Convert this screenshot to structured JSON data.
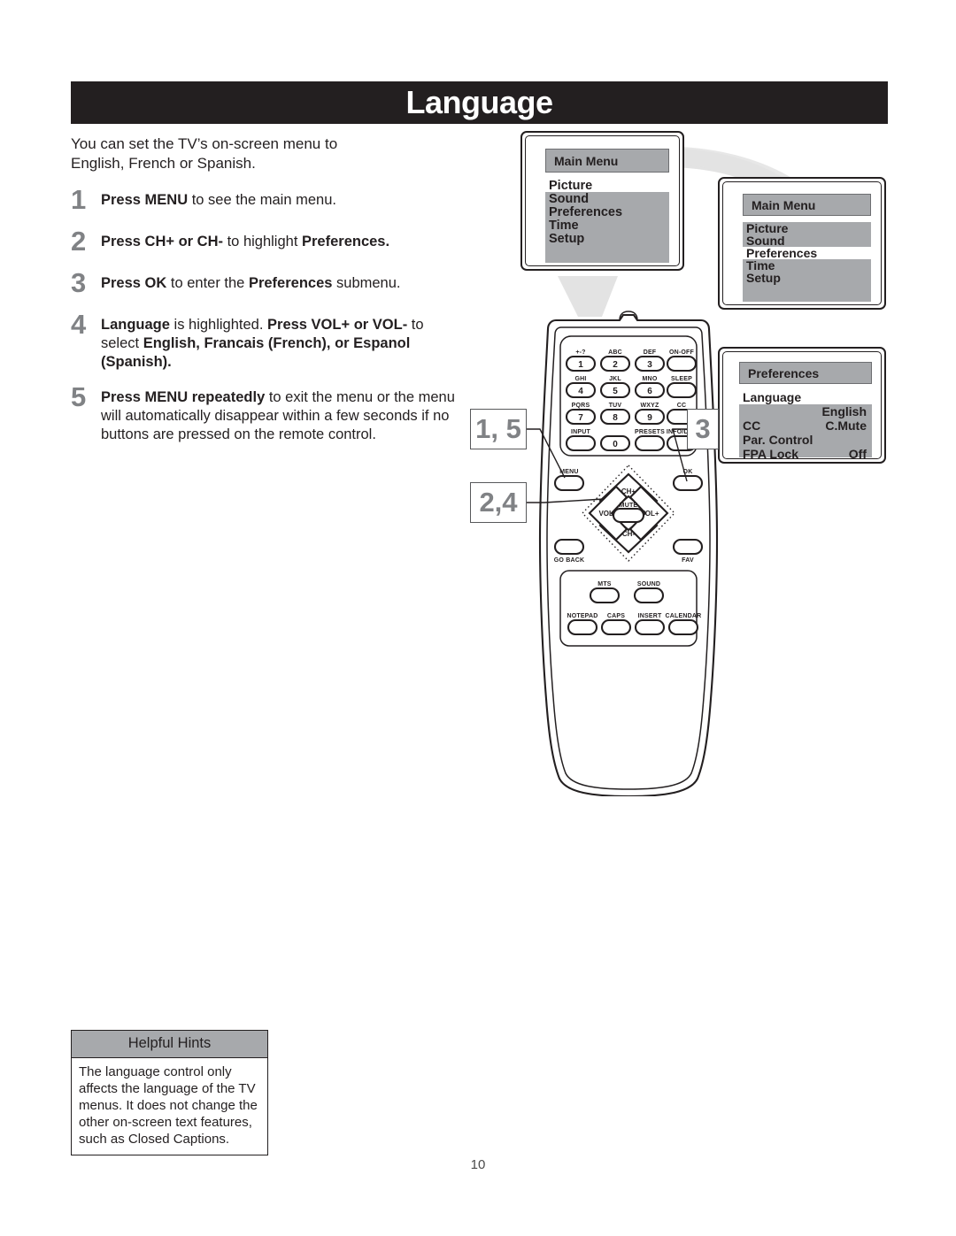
{
  "header": {
    "title": "Language"
  },
  "intro": "You can set the TV’s on-screen menu to English, French or Spanish.",
  "steps": [
    {
      "num": "1",
      "html": "<b>Press MENU</b> to see the main menu."
    },
    {
      "num": "2",
      "html": "<b>Press CH+ or CH-</b> to highlight <b>Preferences.</b>"
    },
    {
      "num": "3",
      "html": "<b>Press OK</b> to enter the <b>Preferences</b> submenu."
    },
    {
      "num": "4",
      "html": "<b>Language</b> is highlighted. <b>Press VOL+ or VOL-</b> to select <b>English, Francais (French), or Espanol (Spanish).</b>"
    },
    {
      "num": "5",
      "html": "<b>Press MENU repeatedly</b> to exit the menu or the menu will automatically disappear within a few seconds if no buttons are pressed on the remote control."
    }
  ],
  "hints": {
    "title": "Helpful Hints",
    "body": "The language control only affects the language of the TV menus. It does not change the other on-screen text features, such as Closed Captions."
  },
  "page_number": "10",
  "screens": {
    "main_menu_1": {
      "title": "Main Menu",
      "items": [
        {
          "label": "Picture",
          "selected": true
        },
        {
          "label": "Sound",
          "selected": false
        },
        {
          "label": "Preferences",
          "selected": false
        },
        {
          "label": "Time",
          "selected": false
        },
        {
          "label": "Setup",
          "selected": false
        }
      ]
    },
    "main_menu_2": {
      "title": "Main Menu",
      "items": [
        {
          "label": "Picture",
          "selected": false
        },
        {
          "label": "Sound",
          "selected": false
        },
        {
          "label": "Preferences",
          "selected": true
        },
        {
          "label": "Time",
          "selected": false
        },
        {
          "label": "Setup",
          "selected": false
        }
      ]
    },
    "preferences": {
      "title": "Preferences",
      "items": [
        {
          "label": "Language",
          "value": "",
          "selected": true
        },
        {
          "label": "",
          "value": "English",
          "selected": false
        },
        {
          "label": "CC",
          "value": "C.Mute",
          "selected": false
        },
        {
          "label": "Par. Control",
          "value": "",
          "selected": false
        },
        {
          "label": "FPA Lock",
          "value": "Off",
          "selected": false
        }
      ]
    }
  },
  "callouts": [
    {
      "id": "callout-15",
      "label": "1, 5",
      "points_to": "MENU"
    },
    {
      "id": "callout-24",
      "label": "2,4",
      "points_to": "VOL-"
    },
    {
      "id": "callout-3",
      "label": "3",
      "points_to": "OK"
    }
  ],
  "remote": {
    "keypad": [
      {
        "top": "+-?",
        "face": "1"
      },
      {
        "top": "ABC",
        "face": "2"
      },
      {
        "top": "DEF",
        "face": "3"
      },
      {
        "top": "ON-OFF",
        "face": ""
      },
      {
        "top": "GHI",
        "face": "4"
      },
      {
        "top": "JKL",
        "face": "5"
      },
      {
        "top": "MNO",
        "face": "6"
      },
      {
        "top": "SLEEP",
        "face": ""
      },
      {
        "top": "PQRS",
        "face": "7"
      },
      {
        "top": "TUV",
        "face": "8"
      },
      {
        "top": "WXYZ",
        "face": "9"
      },
      {
        "top": "CC",
        "face": ""
      },
      {
        "top": "INPUT",
        "face": ""
      },
      {
        "top": "",
        "face": "0"
      },
      {
        "top": "PRESETS",
        "face": ""
      },
      {
        "top": "INFO/DEL",
        "face": ""
      }
    ],
    "nav": {
      "menu": "MENU",
      "ok": "OK",
      "ch_up": "CH+",
      "ch_down": "CH-",
      "vol_down": "VOL-",
      "vol_up": "VOL+",
      "mute": "MUTE",
      "go_back": "GO BACK",
      "fav": "FAV"
    },
    "bottom": [
      {
        "label": "MTS"
      },
      {
        "label": "SOUND"
      },
      {
        "label": "NOTEPAD"
      },
      {
        "label": "CAPS"
      },
      {
        "label": "INSERT"
      },
      {
        "label": "CALENDAR"
      }
    ]
  },
  "colors": {
    "header_bg": "#231f20",
    "osd_gray": "#a7a9ac",
    "step_num_gray": "#808285",
    "swoosh_gray": "#e3e3e3"
  }
}
